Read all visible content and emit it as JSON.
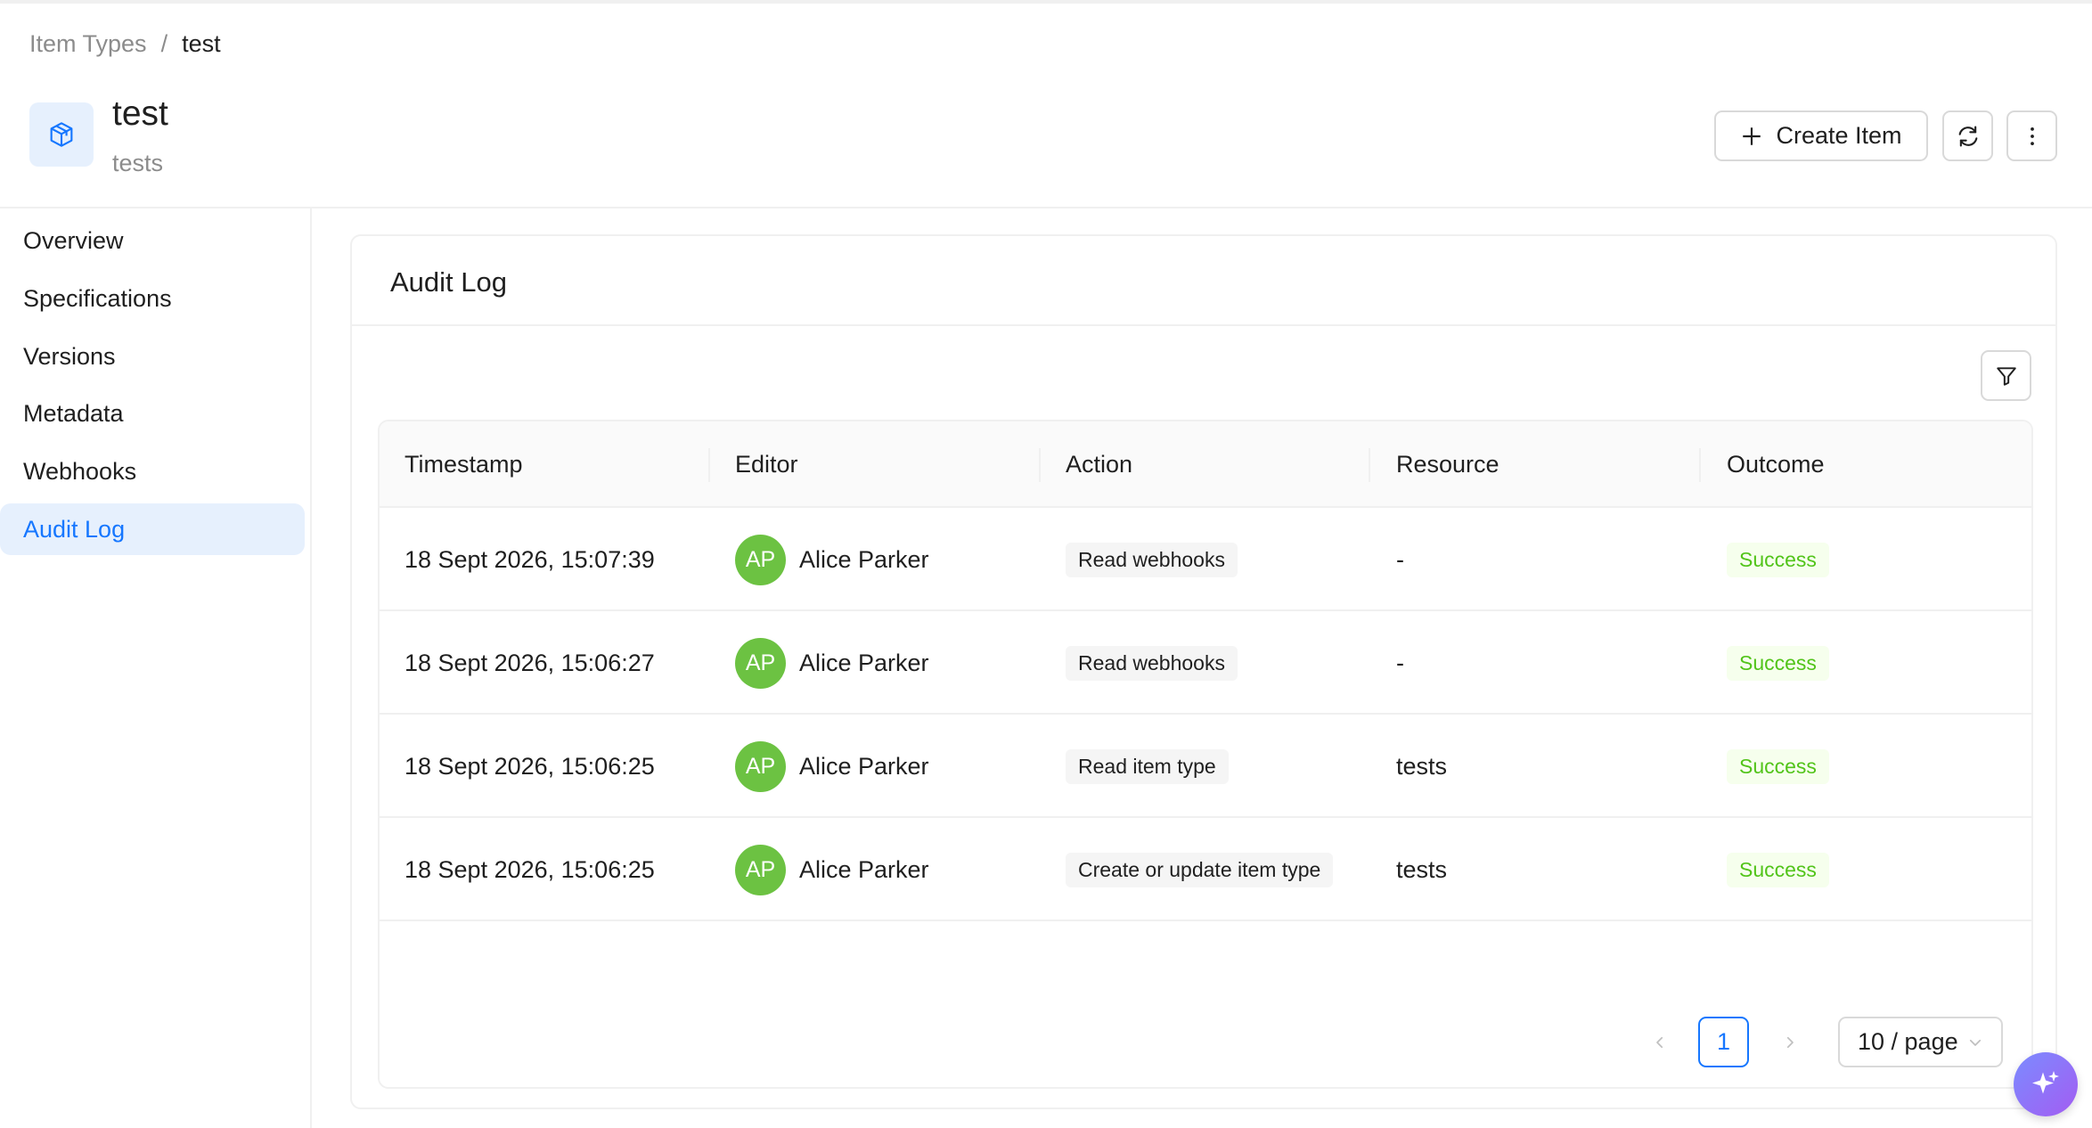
{
  "breadcrumb": {
    "parent": "Item Types",
    "separator": "/",
    "current": "test"
  },
  "header": {
    "icon": "cube-icon",
    "title": "test",
    "subtitle": "tests",
    "create_label": "Create Item",
    "refresh_icon": "refresh-icon",
    "more_icon": "more-vertical-icon"
  },
  "sidebar": {
    "items": [
      {
        "label": "Overview",
        "active": false
      },
      {
        "label": "Specifications",
        "active": false
      },
      {
        "label": "Versions",
        "active": false
      },
      {
        "label": "Metadata",
        "active": false
      },
      {
        "label": "Webhooks",
        "active": false
      },
      {
        "label": "Audit Log",
        "active": true
      }
    ]
  },
  "audit": {
    "title": "Audit Log",
    "filter_icon": "filter-icon",
    "columns": [
      "Timestamp",
      "Editor",
      "Action",
      "Resource",
      "Outcome"
    ],
    "rows": [
      {
        "timestamp": "18 Sept 2026, 15:07:39",
        "initials": "AP",
        "editor": "Alice Parker",
        "action": "Read webhooks",
        "resource": "-",
        "outcome": "Success"
      },
      {
        "timestamp": "18 Sept 2026, 15:06:27",
        "initials": "AP",
        "editor": "Alice Parker",
        "action": "Read webhooks",
        "resource": "-",
        "outcome": "Success"
      },
      {
        "timestamp": "18 Sept 2026, 15:06:25",
        "initials": "AP",
        "editor": "Alice Parker",
        "action": "Read item type",
        "resource": "tests",
        "outcome": "Success"
      },
      {
        "timestamp": "18 Sept 2026, 15:06:25",
        "initials": "AP",
        "editor": "Alice Parker",
        "action": "Create or update item type",
        "resource": "tests",
        "outcome": "Success"
      }
    ]
  },
  "pagination": {
    "current_page": "1",
    "page_size": "10 / page"
  },
  "colors": {
    "accent": "#1677ff",
    "avatar": "#6cc242",
    "success": "#52c41a"
  }
}
